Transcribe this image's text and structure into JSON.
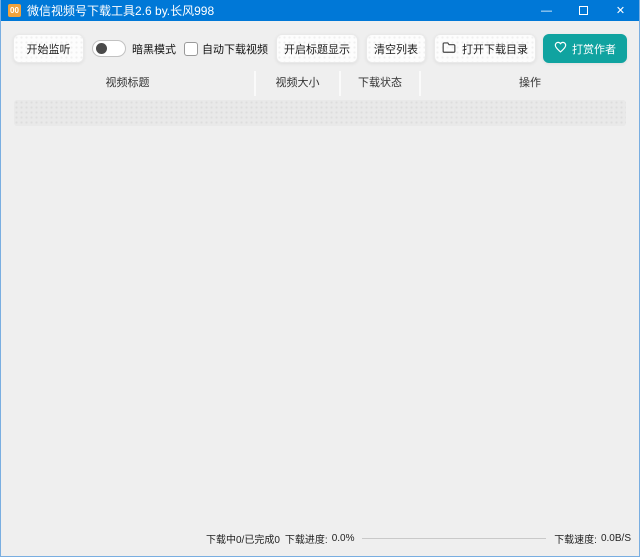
{
  "window": {
    "title": "微信视频号下载工具2.6 by.长风998",
    "app_icon_text": "00",
    "minimize_glyph": "—",
    "close_glyph": "✕",
    "titlebar_color": "#0078D7",
    "border_color": "#79aee1"
  },
  "toolbar": {
    "start_listen": "开始监听",
    "dark_mode_label": "暗黑模式",
    "auto_download_label": "自动下载视频",
    "title_display": "开启标题显示",
    "clear_list": "清空列表",
    "open_dir": "打开下载目录",
    "reward_author": "打赏作者",
    "reward_color": "#10a3a0",
    "dark_mode_state": "off",
    "auto_download_state": "unchecked"
  },
  "table": {
    "headers": [
      "视频标题",
      "视频大小",
      "下载状态",
      "操作"
    ],
    "rows": []
  },
  "statusbar": {
    "counts": "下载中0/已完成0",
    "progress_label": "下载进度:",
    "progress_value": "0.0%",
    "speed_label": "下载速度:",
    "speed_value": "0.0B/S"
  }
}
